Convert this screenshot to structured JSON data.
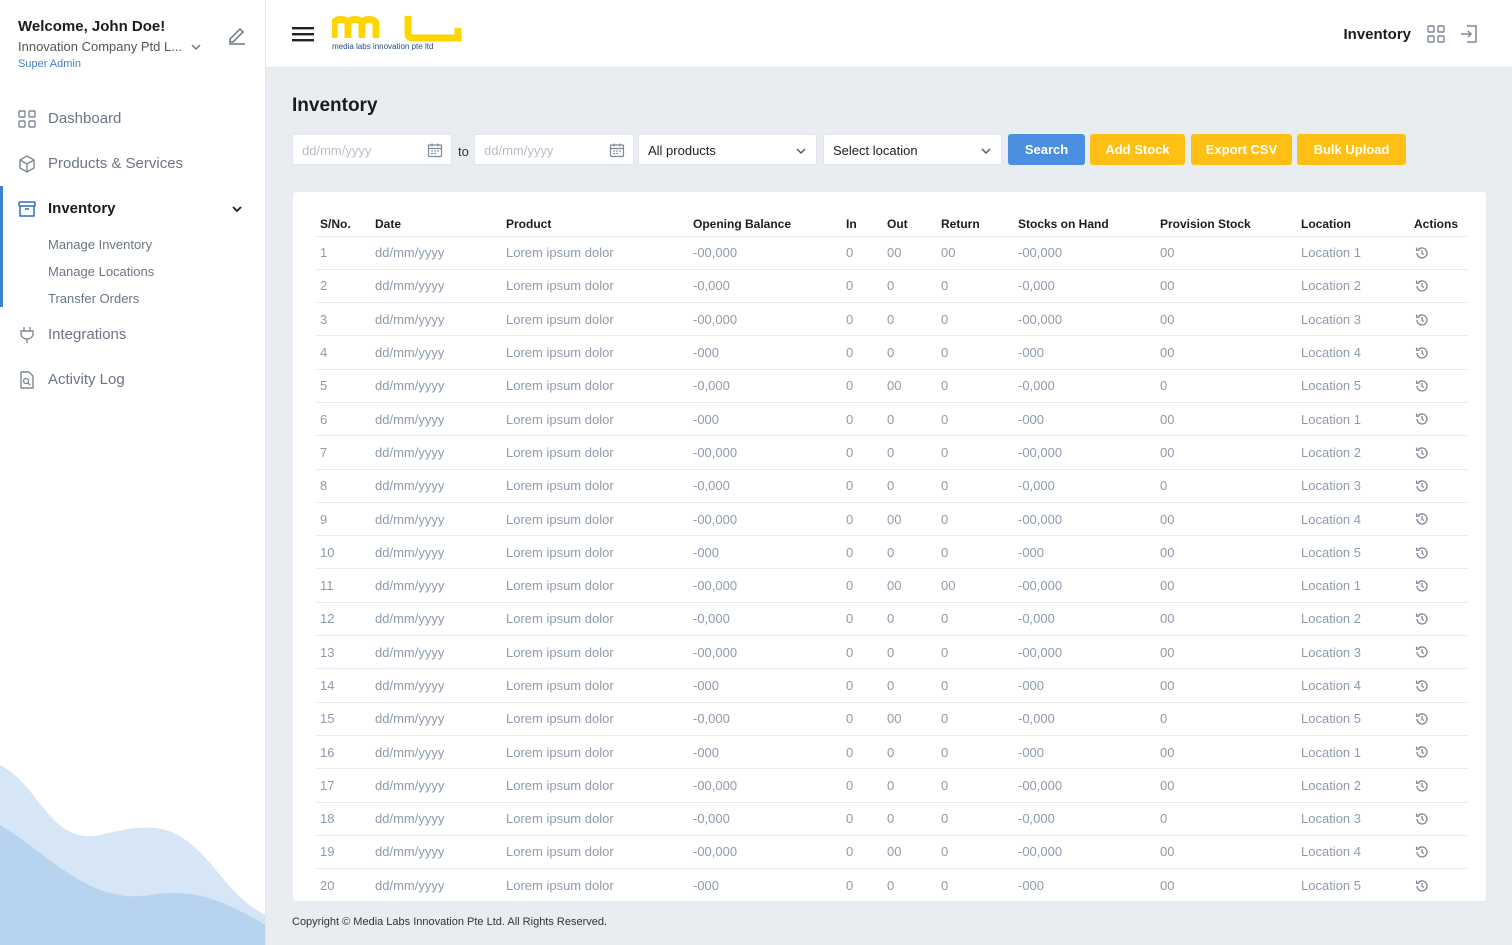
{
  "user": {
    "welcome": "Welcome, John Doe!",
    "company": "Innovation Company Ptd L...",
    "role": "Super Admin"
  },
  "nav": {
    "items": [
      {
        "label": "Dashboard",
        "icon": "grid-icon"
      },
      {
        "label": "Products & Services",
        "icon": "box-icon"
      },
      {
        "label": "Inventory",
        "icon": "archive-icon"
      },
      {
        "label": "Integrations",
        "icon": "plug-icon"
      },
      {
        "label": "Activity Log",
        "icon": "document-search-icon"
      }
    ],
    "inventory_sub": [
      "Manage Inventory",
      "Manage Locations",
      "Transfer Orders"
    ]
  },
  "header": {
    "logo_text": "media labs innovation pte ltd",
    "title": "Inventory"
  },
  "page": {
    "title": "Inventory",
    "filters": {
      "date_from_placeholder": "dd/mm/yyyy",
      "to_label": "to",
      "date_to_placeholder": "dd/mm/yyyy",
      "product_select": "All products",
      "location_select": "Select location"
    },
    "buttons": {
      "search": "Search",
      "add_stock": "Add Stock",
      "export_csv": "Export CSV",
      "bulk_upload": "Bulk Upload"
    }
  },
  "table": {
    "columns": [
      "S/No.",
      "Date",
      "Product",
      "Opening Balance",
      "In",
      "Out",
      "Return",
      "Stocks on Hand",
      "Provision Stock",
      "Location",
      "Actions"
    ],
    "rows": [
      [
        "1",
        "dd/mm/yyyy",
        "Lorem ipsum dolor",
        "-00,000",
        "0",
        "00",
        "00",
        "-00,000",
        "00",
        "Location 1"
      ],
      [
        "2",
        "dd/mm/yyyy",
        "Lorem ipsum dolor",
        "-0,000",
        "0",
        "0",
        "0",
        "-0,000",
        "00",
        "Location 2"
      ],
      [
        "3",
        "dd/mm/yyyy",
        "Lorem ipsum dolor",
        "-00,000",
        "0",
        "0",
        "0",
        "-00,000",
        "00",
        "Location 3"
      ],
      [
        "4",
        "dd/mm/yyyy",
        "Lorem ipsum dolor",
        "-000",
        "0",
        "0",
        "0",
        "-000",
        "00",
        "Location 4"
      ],
      [
        "5",
        "dd/mm/yyyy",
        "Lorem ipsum dolor",
        "-0,000",
        "0",
        "00",
        "0",
        "-0,000",
        "0",
        "Location 5"
      ],
      [
        "6",
        "dd/mm/yyyy",
        "Lorem ipsum dolor",
        "-000",
        "0",
        "0",
        "0",
        "-000",
        "00",
        "Location 1"
      ],
      [
        "7",
        "dd/mm/yyyy",
        "Lorem ipsum dolor",
        "-00,000",
        "0",
        "0",
        "0",
        "-00,000",
        "00",
        "Location 2"
      ],
      [
        "8",
        "dd/mm/yyyy",
        "Lorem ipsum dolor",
        "-0,000",
        "0",
        "0",
        "0",
        "-0,000",
        "0",
        "Location 3"
      ],
      [
        "9",
        "dd/mm/yyyy",
        "Lorem ipsum dolor",
        "-00,000",
        "0",
        "00",
        "0",
        "-00,000",
        "00",
        "Location 4"
      ],
      [
        "10",
        "dd/mm/yyyy",
        "Lorem ipsum dolor",
        "-000",
        "0",
        "0",
        "0",
        "-000",
        "00",
        "Location 5"
      ],
      [
        "11",
        "dd/mm/yyyy",
        "Lorem ipsum dolor",
        "-00,000",
        "0",
        "00",
        "00",
        "-00,000",
        "00",
        "Location 1"
      ],
      [
        "12",
        "dd/mm/yyyy",
        "Lorem ipsum dolor",
        "-0,000",
        "0",
        "0",
        "0",
        "-0,000",
        "00",
        "Location 2"
      ],
      [
        "13",
        "dd/mm/yyyy",
        "Lorem ipsum dolor",
        "-00,000",
        "0",
        "0",
        "0",
        "-00,000",
        "00",
        "Location 3"
      ],
      [
        "14",
        "dd/mm/yyyy",
        "Lorem ipsum dolor",
        "-000",
        "0",
        "0",
        "0",
        "-000",
        "00",
        "Location 4"
      ],
      [
        "15",
        "dd/mm/yyyy",
        "Lorem ipsum dolor",
        "-0,000",
        "0",
        "00",
        "0",
        "-0,000",
        "0",
        "Location 5"
      ],
      [
        "16",
        "dd/mm/yyyy",
        "Lorem ipsum dolor",
        "-000",
        "0",
        "0",
        "0",
        "-000",
        "00",
        "Location 1"
      ],
      [
        "17",
        "dd/mm/yyyy",
        "Lorem ipsum dolor",
        "-00,000",
        "0",
        "0",
        "0",
        "-00,000",
        "00",
        "Location 2"
      ],
      [
        "18",
        "dd/mm/yyyy",
        "Lorem ipsum dolor",
        "-0,000",
        "0",
        "0",
        "0",
        "-0,000",
        "0",
        "Location 3"
      ],
      [
        "19",
        "dd/mm/yyyy",
        "Lorem ipsum dolor",
        "-00,000",
        "0",
        "00",
        "0",
        "-00,000",
        "00",
        "Location 4"
      ],
      [
        "20",
        "dd/mm/yyyy",
        "Lorem ipsum dolor",
        "-000",
        "0",
        "0",
        "0",
        "-000",
        "00",
        "Location 5"
      ]
    ],
    "action_icon": "history-icon"
  },
  "footer": {
    "copyright": "Copyright © Media Labs Innovation Pte Ltd. All Rights Reserved."
  },
  "colors": {
    "accent_blue": "#4b8fe0",
    "accent_yellow": "#ffbf14",
    "logo_yellow": "#ffd500",
    "background": "#e9ecf1"
  }
}
